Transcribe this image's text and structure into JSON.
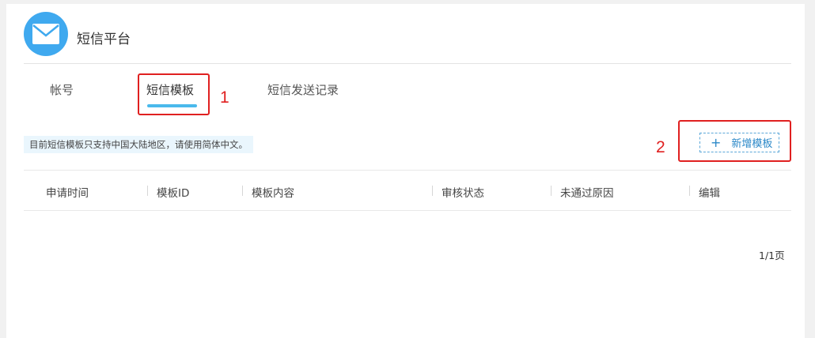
{
  "header": {
    "logo_icon": "envelope-icon",
    "title": "短信平台"
  },
  "tabs": [
    {
      "label": "帐号",
      "active": false
    },
    {
      "label": "短信模板",
      "active": true
    },
    {
      "label": "短信发送记录",
      "active": false
    }
  ],
  "annotations": [
    "1",
    "2"
  ],
  "notice": "目前短信模板只支持中国大陆地区，请使用简体中文。",
  "add_button": {
    "icon": "plus-icon",
    "label": "新增模板"
  },
  "table": {
    "columns": [
      "申请时间",
      "模板ID",
      "模板内容",
      "审核状态",
      "未通过原因",
      "编辑"
    ],
    "rows": []
  },
  "pagination": "1/1页",
  "colors": {
    "accent": "#4ab9ec",
    "logo_bg": "#3fa9ef",
    "annotation": "#e02020",
    "link": "#2b88c8",
    "notice_bg": "#eaf6fd"
  }
}
